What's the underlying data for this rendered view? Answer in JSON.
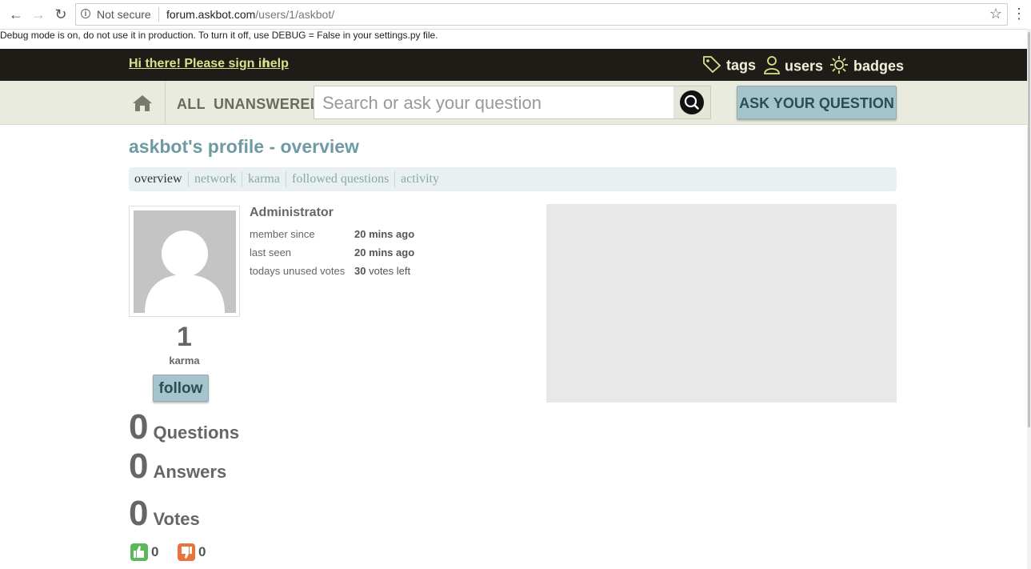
{
  "browser": {
    "security": "Not secure",
    "url_host": "forum.askbot.com",
    "url_path": "/users/1/askbot/"
  },
  "debug_notice": "Debug mode is on, do not use it in production. To turn it off, use DEBUG = False in your settings.py file.",
  "header": {
    "signin": "Hi there! Please sign in",
    "help": "help",
    "nav": {
      "tags": "tags",
      "users": "users",
      "badges": "badges"
    }
  },
  "searchbar": {
    "filter_all": "ALL",
    "filter_unanswered": "UNANSWERED",
    "placeholder": "Search or ask your question",
    "ask_label": "ASK YOUR QUESTION"
  },
  "profile": {
    "title": "askbot's profile - overview",
    "tabs": [
      "overview",
      "network",
      "karma",
      "followed questions",
      "activity"
    ],
    "karma_value": "1",
    "karma_label": "karma",
    "follow_label": "follow",
    "name": "Administrator",
    "member_since_label": "member since",
    "member_since_value": "20 mins ago",
    "last_seen_label": "last seen",
    "last_seen_value": "20 mins ago",
    "votes_label": "todays unused votes",
    "votes_value": "30",
    "votes_suffix": "votes left",
    "stats": {
      "questions_count": "0",
      "questions_label": "Questions",
      "answers_count": "0",
      "answers_label": "Answers",
      "votes_count": "0",
      "votes_label": "Votes",
      "upvotes": "0",
      "downvotes": "0"
    }
  },
  "colors": {
    "accent": "#6e9aa3",
    "topbar": "#1e1c17",
    "signin_link": "#d7e28e",
    "button": "#a6c4cb",
    "upvote": "#5cb85c",
    "downvote": "#e8743b"
  },
  "icons": [
    "back-arrow-icon",
    "forward-arrow-icon",
    "reload-icon",
    "info-icon",
    "star-icon",
    "menu-dots-icon",
    "tag-icon",
    "user-icon",
    "badge-icon",
    "home-icon",
    "search-icon",
    "thumbs-up-icon",
    "thumbs-down-icon"
  ]
}
